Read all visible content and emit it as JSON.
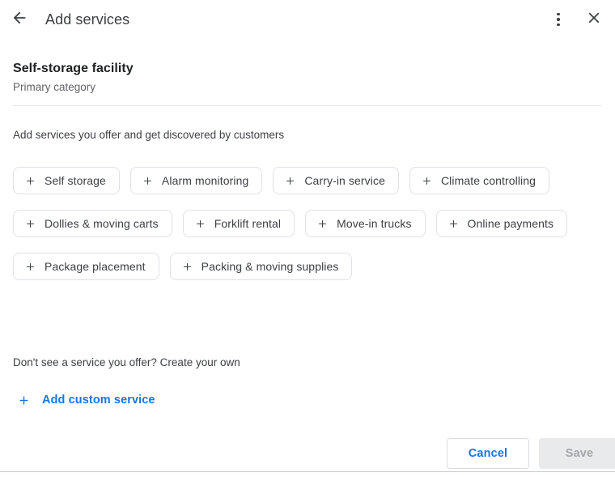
{
  "header": {
    "title": "Add services",
    "back_icon": "back-arrow-icon",
    "more_icon": "more-vert-icon",
    "close_icon": "close-icon"
  },
  "category": {
    "name": "Self-storage facility",
    "subtitle": "Primary category"
  },
  "body": {
    "subtitle": "Add services you offer and get discovered by customers",
    "chips": [
      {
        "label": "Self storage"
      },
      {
        "label": "Alarm monitoring"
      },
      {
        "label": "Carry-in service"
      },
      {
        "label": "Climate controlling"
      },
      {
        "label": "Dollies & moving carts"
      },
      {
        "label": "Forklift rental"
      },
      {
        "label": "Move-in trucks"
      },
      {
        "label": "Online payments"
      },
      {
        "label": "Package placement"
      },
      {
        "label": "Packing & moving supplies"
      }
    ],
    "custom_note": "Don't see a service you offer? Create your own",
    "custom_link": "Add custom service"
  },
  "footer": {
    "cancel_label": "Cancel",
    "save_label": "Save",
    "save_disabled": true
  },
  "colors": {
    "accent_blue": "#1a73e8",
    "text_primary": "#202124",
    "text_secondary": "#5f6368",
    "chip_border": "#dfe1e5",
    "divider": "#e4e6e8",
    "disabled_bg": "#e9eaeb",
    "disabled_text": "#a3a7ab"
  }
}
